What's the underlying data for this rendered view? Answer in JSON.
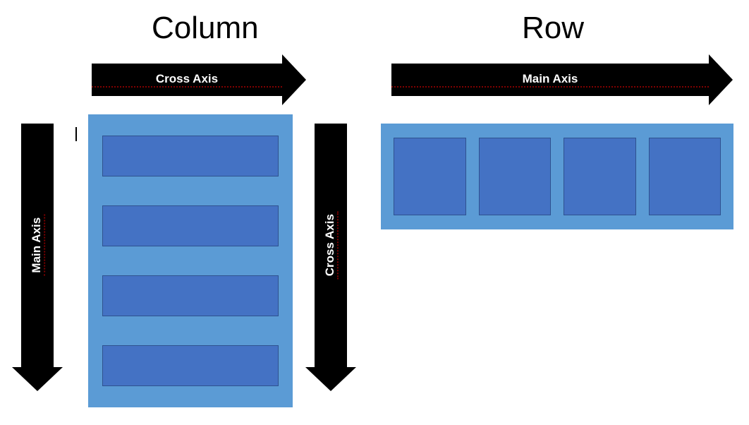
{
  "titles": {
    "column": "Column",
    "row": "Row"
  },
  "arrows": {
    "column_cross": "Cross Axis",
    "column_main": "Main Axis",
    "row_main": "Main Axis",
    "row_cross": "Cross Axis"
  },
  "layout": {
    "column_items": 4,
    "row_items": 4,
    "colors": {
      "container": "#5B9BD5",
      "item": "#4472C4",
      "arrow": "#000000"
    }
  }
}
